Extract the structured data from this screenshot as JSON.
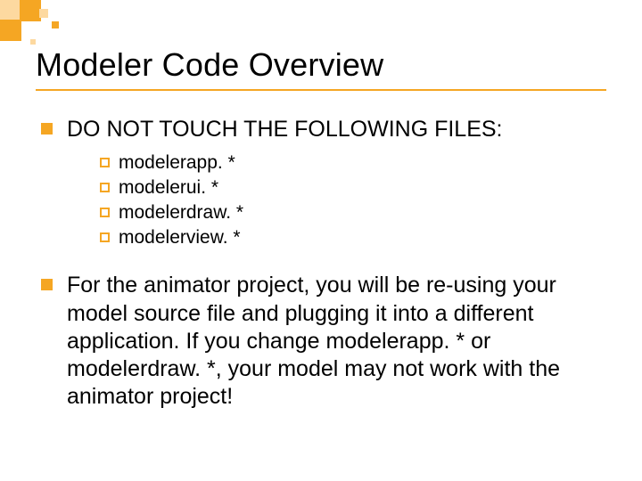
{
  "title": "Modeler Code Overview",
  "bullets": [
    {
      "text": "DO NOT TOUCH THE FOLLOWING FILES:",
      "sub": [
        "modelerapp. *",
        "modelerui. *",
        "modelerdraw. *",
        "modelerview. *"
      ]
    },
    {
      "text": "For the animator project, you will be re-using your model source file and plugging it into a different application. If you change modelerapp. * or modelerdraw. *, your model may not work with the animator project!",
      "sub": []
    }
  ]
}
